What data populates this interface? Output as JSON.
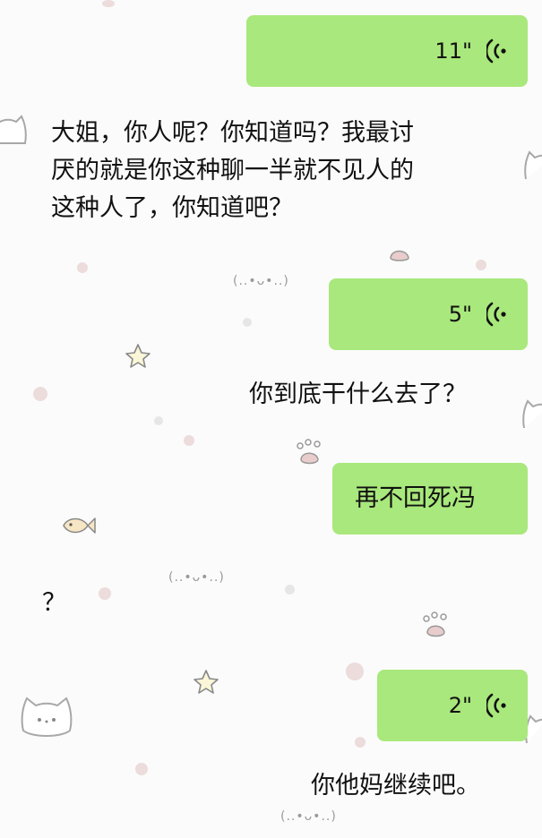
{
  "messages": [
    {
      "type": "voice",
      "side": "sent",
      "duration": "11\""
    },
    {
      "type": "text",
      "side": "recv",
      "lines": [
        "大姐，你人呢？你知道吗？我最讨",
        "厌的就是你这种聊一半就不见人的",
        "这种人了，你知道吧？"
      ]
    },
    {
      "type": "voice",
      "side": "sent",
      "duration": "5\""
    },
    {
      "type": "text",
      "side": "recv",
      "text": "你到底干什么去了？"
    },
    {
      "type": "text",
      "side": "sent",
      "text": "再不回死冯"
    },
    {
      "type": "text",
      "side": "recv",
      "text": "？"
    },
    {
      "type": "voice",
      "side": "sent",
      "duration": "2\""
    },
    {
      "type": "text",
      "side": "recv",
      "text": "你他妈继续吧。"
    }
  ],
  "wallpaper": {
    "kaomoji": [
      "(..•ᴗ•..)",
      "(..•ᴗ•..)",
      "(..•ᴗ•..)"
    ]
  },
  "colors": {
    "sent_bubble": "#a9e87c",
    "background": "#fbfbfb",
    "text": "#111111"
  }
}
